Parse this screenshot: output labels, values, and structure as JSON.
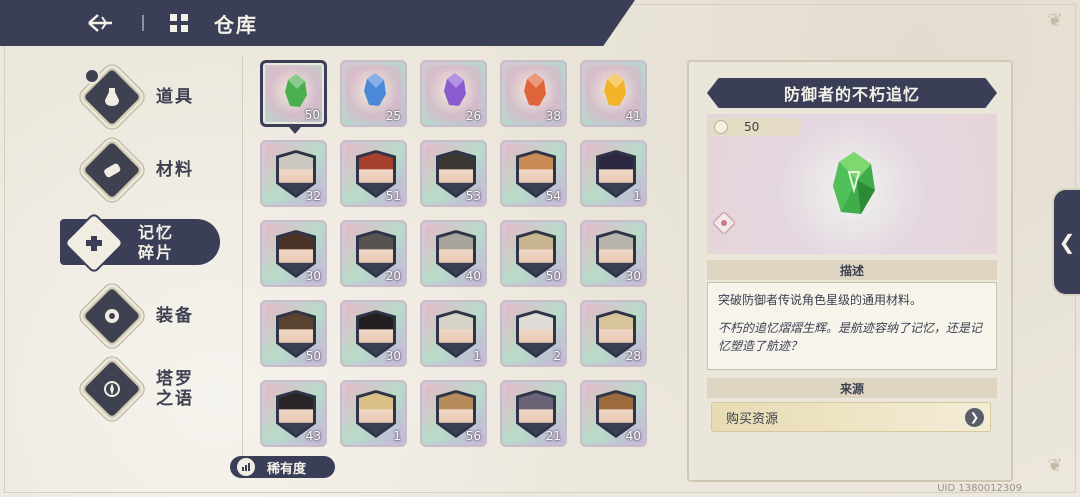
{
  "header": {
    "title": "仓库"
  },
  "nav": {
    "items": [
      {
        "label": "道具",
        "icon": "potion-icon"
      },
      {
        "label": "材料",
        "icon": "scroll-icon"
      },
      {
        "label": "记忆\n碎片",
        "line1": "记忆",
        "line2": "碎片",
        "icon": "puzzle-icon",
        "active": true
      },
      {
        "label": "装备",
        "icon": "equipment-icon"
      },
      {
        "label": "塔罗\n之语",
        "line1": "塔罗",
        "line2": "之语",
        "icon": "tarot-icon"
      }
    ]
  },
  "grid": {
    "cells": [
      {
        "kind": "crystal",
        "color": "#4caf50",
        "count": "50",
        "selected": true
      },
      {
        "kind": "crystal",
        "color": "#4a88d8",
        "count": "25"
      },
      {
        "kind": "crystal",
        "color": "#8b5bd0",
        "count": "26"
      },
      {
        "kind": "crystal",
        "color": "#e0643a",
        "count": "38"
      },
      {
        "kind": "crystal",
        "color": "#f2b52a",
        "count": "41"
      },
      {
        "kind": "portrait",
        "hair": "#ccc7c0",
        "count": "32"
      },
      {
        "kind": "portrait",
        "hair": "#a7402d",
        "count": "51"
      },
      {
        "kind": "portrait",
        "hair": "#3d3733",
        "count": "53"
      },
      {
        "kind": "portrait",
        "hair": "#c98b54",
        "count": "54"
      },
      {
        "kind": "portrait",
        "hair": "#2b2740",
        "count": "1"
      },
      {
        "kind": "portrait",
        "hair": "#4b3327",
        "count": "30"
      },
      {
        "kind": "portrait",
        "hair": "#585350",
        "count": "20"
      },
      {
        "kind": "portrait",
        "hair": "#a9a59c",
        "count": "40"
      },
      {
        "kind": "portrait",
        "hair": "#c7b58f",
        "count": "50"
      },
      {
        "kind": "portrait",
        "hair": "#b8b4ad",
        "count": "30"
      },
      {
        "kind": "portrait",
        "hair": "#5a4230",
        "count": "50"
      },
      {
        "kind": "portrait",
        "hair": "#231e1f",
        "count": "30"
      },
      {
        "kind": "portrait",
        "hair": "#d6d2c8",
        "count": "1"
      },
      {
        "kind": "portrait",
        "hair": "#e0ddd8",
        "count": "2"
      },
      {
        "kind": "portrait",
        "hair": "#d8c49a",
        "count": "28"
      },
      {
        "kind": "portrait",
        "hair": "#2a2426",
        "count": "43"
      },
      {
        "kind": "portrait",
        "hair": "#d9c089",
        "count": "1"
      },
      {
        "kind": "portrait",
        "hair": "#b58b5c",
        "count": "56"
      },
      {
        "kind": "portrait",
        "hair": "#6c6476",
        "count": "21"
      },
      {
        "kind": "portrait",
        "hair": "#9c6a3d",
        "count": "40"
      }
    ]
  },
  "rarity": {
    "label": "稀有度"
  },
  "detail": {
    "title": "防御者的不朽追忆",
    "quantity": "50",
    "desc_head": "描述",
    "desc_main": "突破防御者传说角色星级的通用材料。",
    "desc_flavor": "不朽的追忆熠熠生辉。是航迹容纳了记忆，还是记忆塑造了航迹？",
    "source_head": "来源",
    "source_label": "购买资源"
  },
  "footer": {
    "uid": "UID 1380012309"
  },
  "side_tab": {
    "label": "❮"
  },
  "colors": {
    "primary": "#3a3f57",
    "background": "#ece7dc",
    "crystal_green": "#4caf50"
  }
}
